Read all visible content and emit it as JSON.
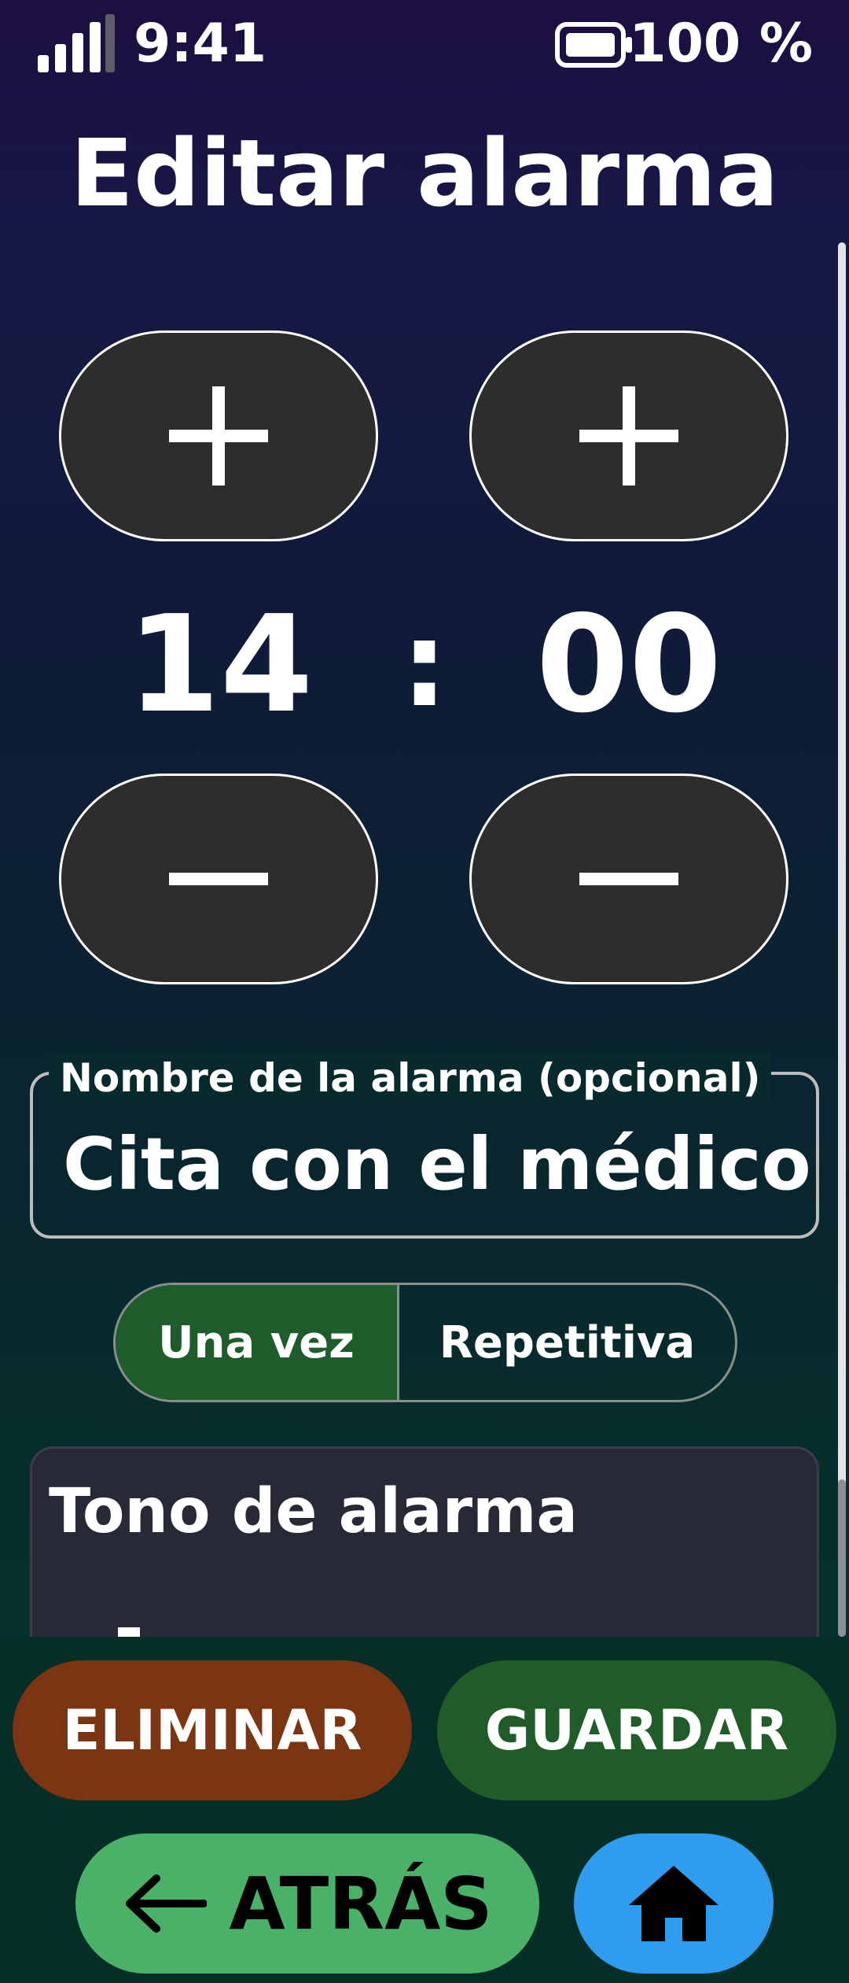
{
  "status_bar": {
    "time": "9:41",
    "battery": "100 %",
    "signal_icon": "signal-icon",
    "battery_icon": "battery-icon"
  },
  "page": {
    "title": "Editar alarma"
  },
  "time_picker": {
    "hour": "14",
    "separator": ":",
    "minute": "00",
    "increment_icon": "plus-icon",
    "decrement_icon": "minus-icon"
  },
  "name_field": {
    "label": "Nombre de la alarma (opcional)",
    "value": "Cita con el médico"
  },
  "repeat_mode": {
    "options": [
      "Una vez",
      "Repetitiva"
    ],
    "selected": "Una vez"
  },
  "tone": {
    "title": "Tono de alarma"
  },
  "actions": {
    "delete_label": "ELIMINAR",
    "save_label": "GUARDAR",
    "back_label": "ATRÁS",
    "back_icon": "arrow-left-icon",
    "home_icon": "home-icon"
  },
  "colors": {
    "delete": "#7c3512",
    "save": "#1f5c2a",
    "back": "#49b168",
    "home": "#2e9df0",
    "selected_segment": "#1e5c2b",
    "stepper": "#2d2d2d"
  }
}
